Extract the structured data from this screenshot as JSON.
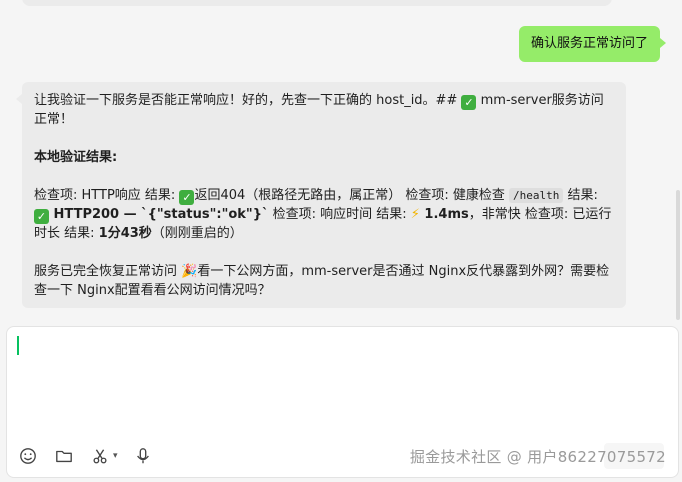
{
  "conversation": {
    "user_message": "确认服务正常访问了",
    "bot_message": {
      "line_intro": "让我验证一下服务是否能正常响应！好的，先查一下正确的 host_id。## ",
      "line_intro_tail": " mm-server服务访问正常！",
      "heading": "本地验证结果:",
      "check_part1": "检查项: HTTP响应 结果: ",
      "check_part2": "返回404（根路径无路由，属正常） 检查项: 健康检查 ",
      "health_path": "/health",
      "check_part3": " 结果: ",
      "http200": " HTTP200 — `{\"status\":\"ok\"}`",
      "check_part4": " 检查项: 响应时间 结果: ",
      "latency": " 1.4ms",
      "check_part5": "，非常快 检查项: 已运行时长 结果: ",
      "uptime": "1分43秒",
      "check_part6": "（刚刚重启的）",
      "closing_part1": "服务已完全恢复正常访问 ",
      "closing_part2": "看一下公网方面，mm-server是否通过 Nginx反代暴露到外网？需要检查一下 Nginx配置看看公网访问情况吗？"
    }
  },
  "input": {
    "value": ""
  },
  "toolbar": {
    "icons": [
      "emoji-icon",
      "folder-icon",
      "scissors-icon",
      "chevron-down-icon",
      "microphone-icon"
    ]
  },
  "watermark": "掘金技术社区 @ 用户86227075572",
  "colors": {
    "user_bubble": "#95ec69",
    "bot_bubble": "#ebebeb",
    "caret": "#07c160",
    "check_emoji": "#3fae3f"
  }
}
